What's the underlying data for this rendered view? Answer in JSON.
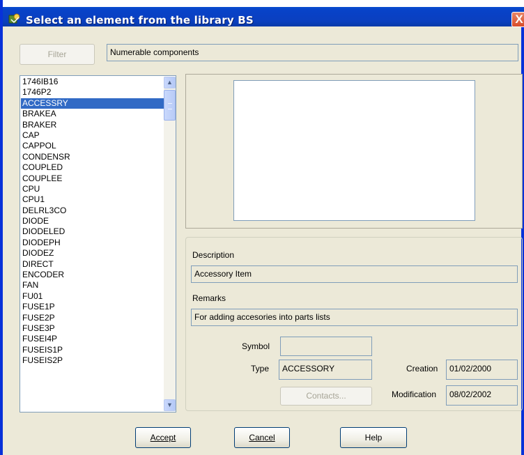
{
  "window": {
    "title": "Select an element from the library BS",
    "close_glyph": "X"
  },
  "filter": {
    "button_label": "Filter",
    "value": "Numerable components"
  },
  "list": {
    "selected": "ACCESSRY",
    "items": [
      "1746IB16",
      "1746P2",
      "ACCESSRY",
      "BRAKEA",
      "BRAKER",
      "CAP",
      "CAPPOL",
      "CONDENSR",
      "COUPLED",
      "COUPLEE",
      "CPU",
      "CPU1",
      "DELRL3CO",
      "DIODE",
      "DIODELED",
      "DIODEPH",
      "DIODEZ",
      "DIRECT",
      "ENCODER",
      "FAN",
      "FU01",
      "FUSE1P",
      "FUSE2P",
      "FUSE3P",
      "FUSEI4P",
      "FUSEIS1P",
      "FUSEIS2P"
    ]
  },
  "details": {
    "description_label": "Description",
    "description_value": "Accessory Item",
    "remarks_label": "Remarks",
    "remarks_value": "For adding accesories into parts lists",
    "symbol_label": "Symbol",
    "symbol_value": "",
    "type_label": "Type",
    "type_value": "ACCESSORY",
    "creation_label": "Creation",
    "creation_value": "01/02/2000",
    "modification_label": "Modification",
    "modification_value": "08/02/2002",
    "contacts_button": "Contacts..."
  },
  "footer": {
    "accept_label": "Accept",
    "cancel_label": "Cancel",
    "help_label": "Help"
  },
  "icons": {
    "title_icon": "library-icon",
    "scroll_up": "arrow-up-icon",
    "scroll_down": "arrow-down-icon"
  },
  "colors": {
    "titlebar": "#0a5fdb",
    "selection": "#316ac5",
    "close_button": "#d84c2a",
    "dialog_background": "#ece9d8"
  }
}
